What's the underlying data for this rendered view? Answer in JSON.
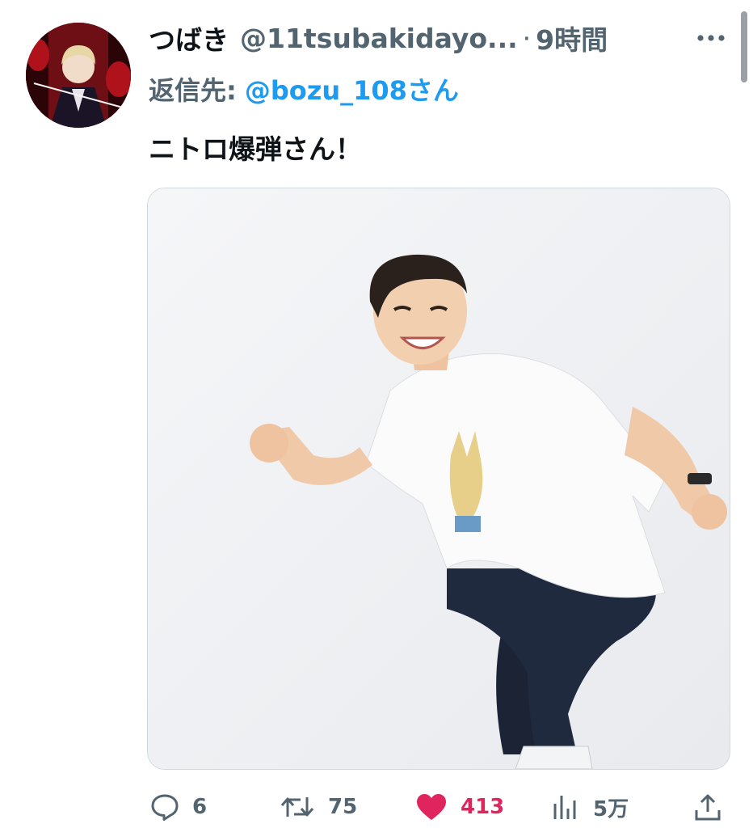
{
  "tweet": {
    "author": {
      "display_name": "つばき",
      "handle": "@11tsubakidayo..."
    },
    "separator": "·",
    "time": "9時間",
    "reply": {
      "prefix": "返信先:",
      "mention": "@bozu_108さん"
    },
    "text": "ニトロ爆弾さん！",
    "media": {
      "type": "photo",
      "description_icon": "photo"
    },
    "actions": {
      "reply": {
        "icon": "reply-icon",
        "count": "6"
      },
      "retweet": {
        "icon": "retweet-icon",
        "count": "75"
      },
      "like": {
        "icon": "heart-icon",
        "count": "413",
        "active": true,
        "color": "#e0245e"
      },
      "views": {
        "icon": "views-icon",
        "count": "5万"
      },
      "share": {
        "icon": "share-icon"
      }
    }
  },
  "colors": {
    "text": "#0f1419",
    "secondary": "#536471",
    "link": "#1d9bf0",
    "like": "#e0245e",
    "border": "#cfd9de"
  }
}
